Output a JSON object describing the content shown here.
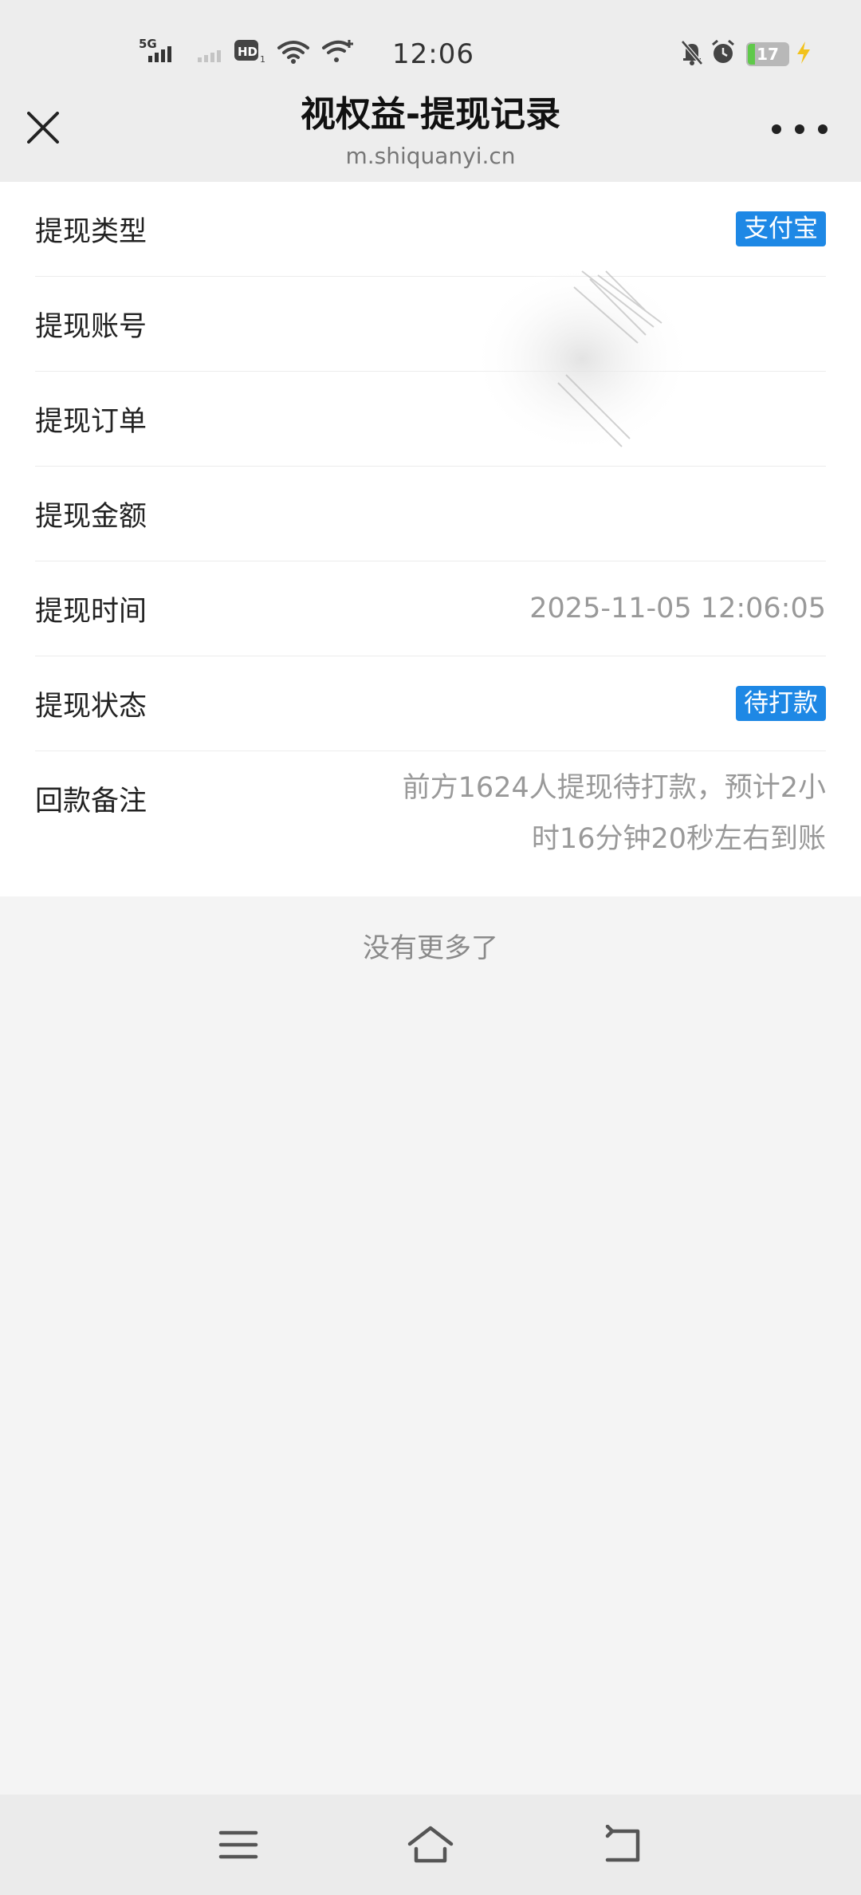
{
  "status_bar": {
    "network": "5G",
    "hd": "HD",
    "hd_sub": "1",
    "time": "12:06",
    "battery": "17",
    "battery_level": 0.17,
    "icons": [
      "signal-icon",
      "signal-weak-icon",
      "hd-icon",
      "wifi-icon",
      "wifi-plus-icon",
      "mute-icon",
      "alarm-icon",
      "battery-icon",
      "charging-icon"
    ]
  },
  "header": {
    "title": "视权益-提现记录",
    "url": "m.shiquanyi.cn"
  },
  "details": [
    {
      "label": "提现类型",
      "value": "支付宝",
      "tag": true
    },
    {
      "label": "提现账号",
      "value": "",
      "tag": false
    },
    {
      "label": "提现订单",
      "value": "",
      "tag": false
    },
    {
      "label": "提现金额",
      "value": "",
      "tag": false
    },
    {
      "label": "提现时间",
      "value": "2025-11-05 12:06:05",
      "tag": false
    },
    {
      "label": "提现状态",
      "value": "待打款",
      "tag": true
    },
    {
      "label": "回款备注",
      "value": "前方1624人提现待打款，预计2小时16分钟20秒左右到账",
      "tag": false
    }
  ],
  "footer": {
    "no_more": "没有更多了"
  },
  "colors": {
    "tag_blue": "#1e88e5",
    "header_bg": "#ededed",
    "page_bg": "#f4f4f4"
  }
}
